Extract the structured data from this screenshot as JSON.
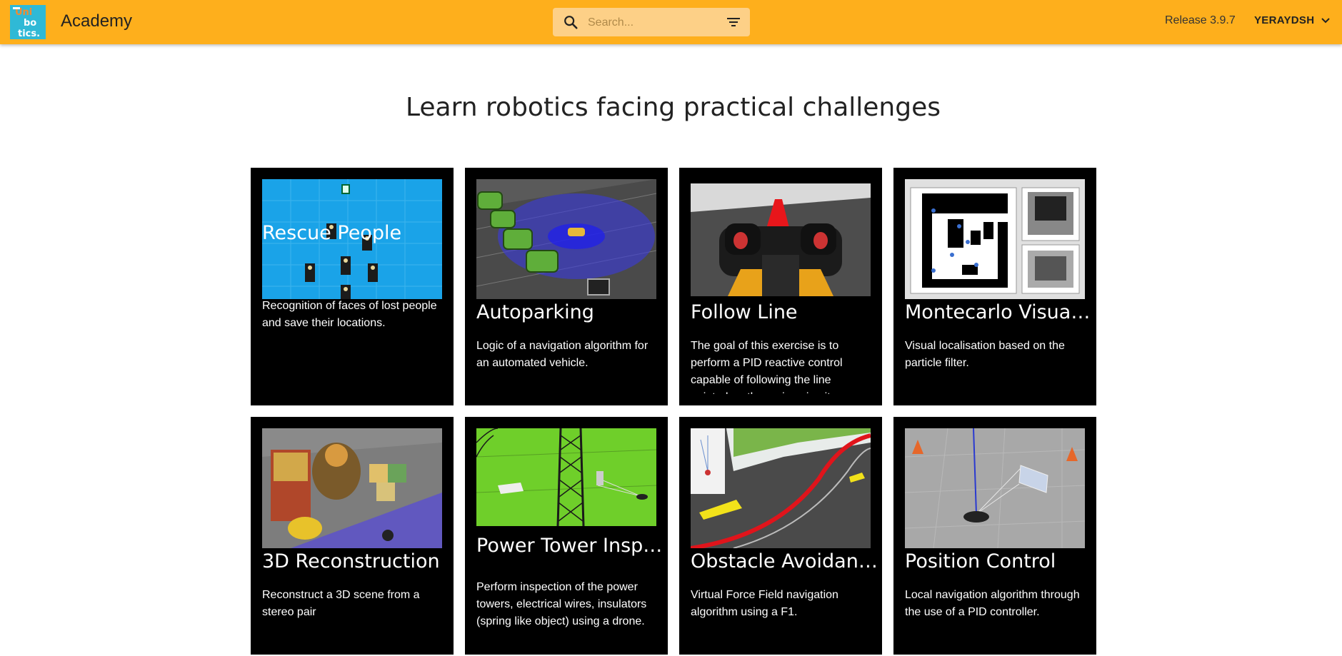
{
  "header": {
    "logo_lines": [
      "Uni",
      "bo",
      "tics."
    ],
    "app_title": "Academy",
    "search_placeholder": "Search...",
    "release": "Release 3.9.7",
    "username": "YERAYDSH",
    "brand_color": "#feaf1c"
  },
  "main": {
    "headline": "Learn robotics facing practical challenges",
    "cards": [
      {
        "title": "Rescue People",
        "description": "Recognition of faces of lost people and save their locations."
      },
      {
        "title": "Autoparking",
        "description": "Logic of a navigation algorithm for an automated vehicle."
      },
      {
        "title": "Follow Line",
        "description": "The goal of this exercise is to perform a PID reactive control capable of following the line painted on the racing circuit."
      },
      {
        "title": "Montecarlo Visual Loc",
        "description": "Visual localisation based on the particle filter."
      },
      {
        "title": "3D Reconstruction",
        "description": "Reconstruct a 3D scene from a stereo pair"
      },
      {
        "title": "Power Tower Inspection",
        "description": "Perform inspection of the power towers, electrical wires, insulators (spring like object) using a drone."
      },
      {
        "title": "Obstacle Avoidance",
        "description": "Virtual Force Field navigation algorithm using a F1."
      },
      {
        "title": "Position Control",
        "description": "Local navigation algorithm through the use of a PID controller."
      }
    ]
  }
}
